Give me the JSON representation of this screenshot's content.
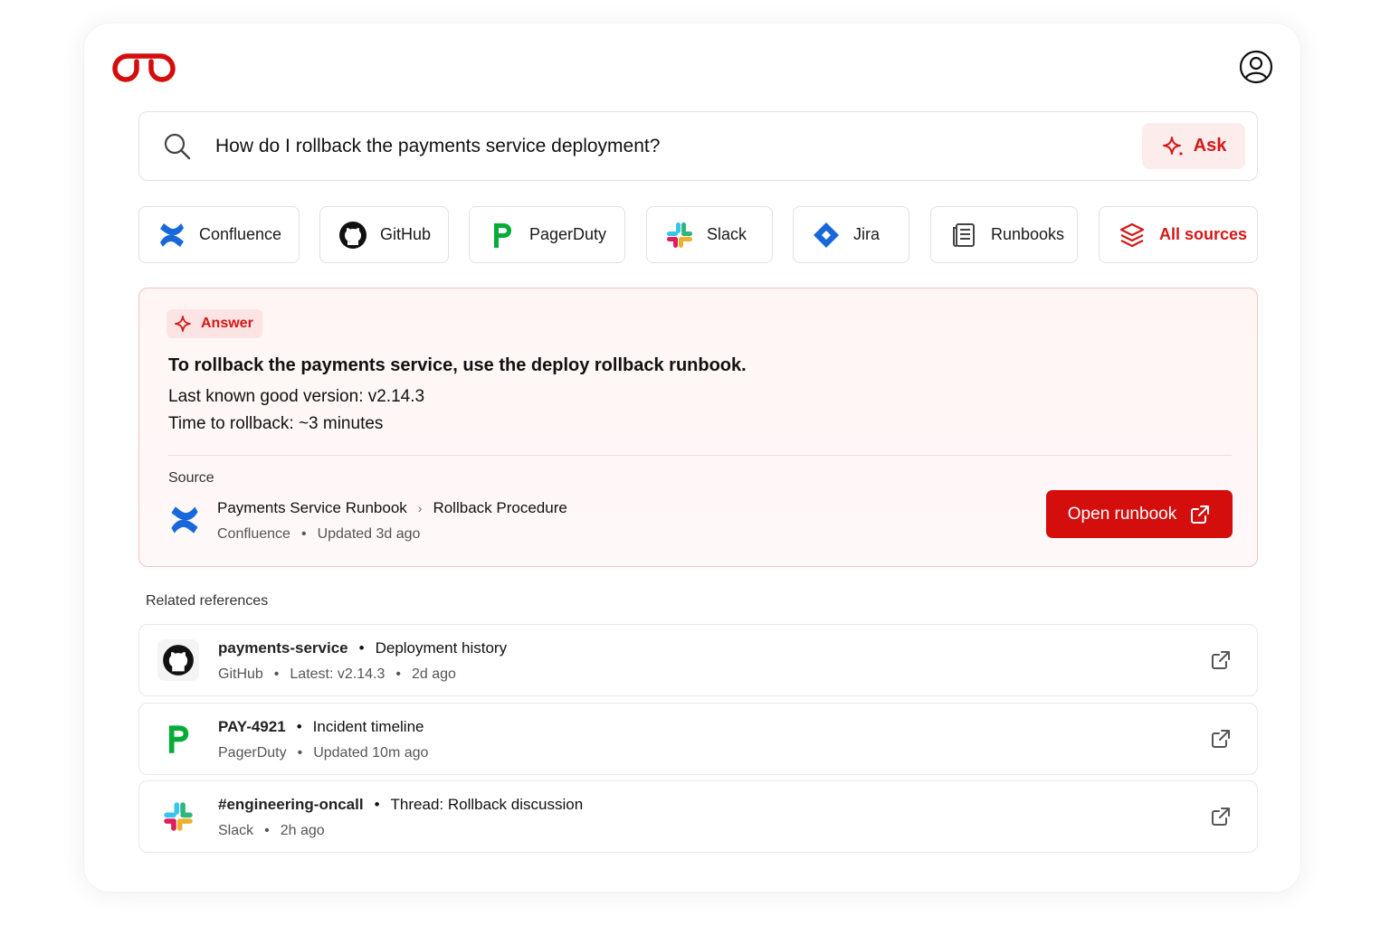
{
  "search": {
    "query": "How do I rollback the payments service deployment?",
    "ask_label": "Ask"
  },
  "sources": [
    "Confluence",
    "GitHub",
    "PagerDuty",
    "Slack",
    "Jira",
    "Runbooks",
    "All sources"
  ],
  "answer": {
    "badge": "Answer",
    "title": "To rollback the payments service, use the deploy rollback runbook.",
    "line1": "Last known good version: v2.14.3",
    "line2": "Time to rollback: ~3 minutes",
    "source_label": "Source",
    "source_page": "Payments Service Runbook",
    "source_section": "Rollback Procedure",
    "source_app": "Confluence",
    "source_updated": "Updated 3d ago",
    "open_label": "Open runbook"
  },
  "related": {
    "label": "Related references",
    "items": [
      {
        "name": "payments-service",
        "desc": "Deployment history",
        "meta": [
          "GitHub",
          "Latest: v2.14.3",
          "2d ago"
        ]
      },
      {
        "name": "PAY-4921",
        "desc": "Incident timeline",
        "meta": [
          "PagerDuty",
          "Updated 10m ago"
        ]
      },
      {
        "name": "#engineering-oncall",
        "desc": "Thread: Rollback discussion",
        "meta": [
          "Slack",
          "2h ago"
        ]
      }
    ]
  },
  "colors": {
    "accent": "#d40d0d",
    "confluence": "#1868db",
    "pagerduty": "#06ac38",
    "jira": "#1868db"
  }
}
